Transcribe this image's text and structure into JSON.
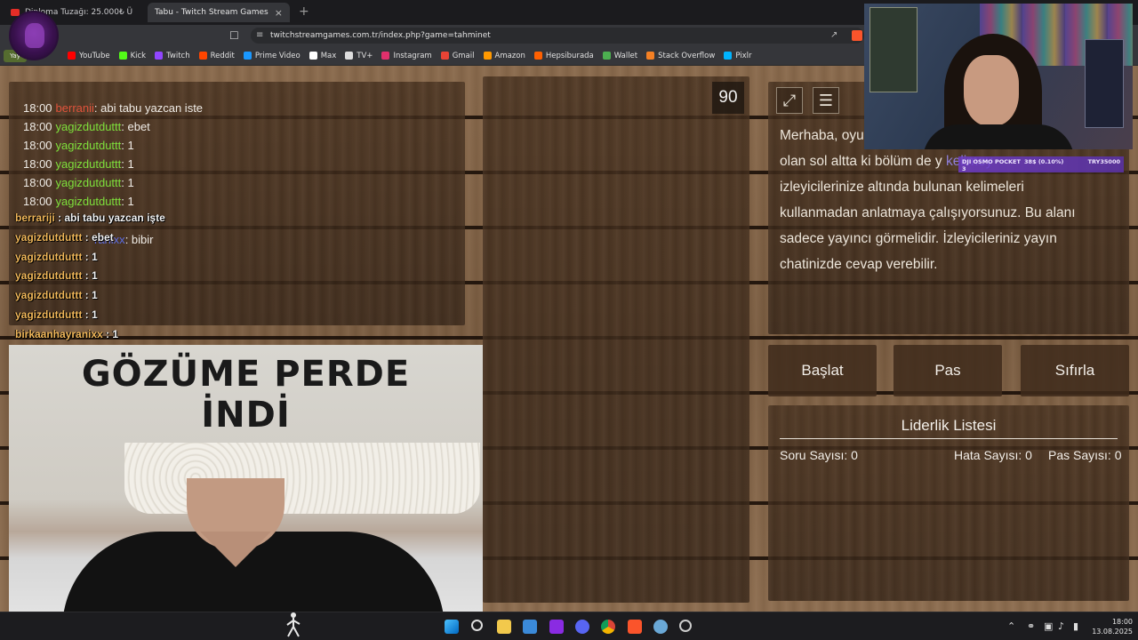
{
  "browser": {
    "tabs": [
      {
        "title": "Diploma Tuzağı: 25.000₺ Ü",
        "close": ""
      },
      {
        "title": "Tabu - Twitch Stream Games",
        "close": "×"
      }
    ],
    "new_tab": "+",
    "url": "twitchstreamgames.com.tr/index.php?game=tahminet",
    "badge": "Yay",
    "bookmarks": [
      {
        "label": "YouTube",
        "color": "#ff0000"
      },
      {
        "label": "Kick",
        "color": "#53fc18"
      },
      {
        "label": "Twitch",
        "color": "#9146ff"
      },
      {
        "label": "Reddit",
        "color": "#ff4500"
      },
      {
        "label": "Prime Video",
        "color": "#1a98ff"
      },
      {
        "label": "Max",
        "color": "#ffffff"
      },
      {
        "label": "TV+",
        "color": "#dddddd"
      },
      {
        "label": "Instagram",
        "color": "#e1306c"
      },
      {
        "label": "Gmail",
        "color": "#ea4335"
      },
      {
        "label": "Amazon",
        "color": "#ff9900"
      },
      {
        "label": "Hepsiburada",
        "color": "#ff6000"
      },
      {
        "label": "Wallet",
        "color": "#4caf50"
      },
      {
        "label": "Stack Overflow",
        "color": "#f48024"
      },
      {
        "label": "Pixlr",
        "color": "#00b4ff"
      }
    ]
  },
  "chat": {
    "lines": [
      {
        "time": "18:00",
        "user": "berranii",
        "user_color": "#e0533b",
        "msg": ": abi tabu yazcan iste"
      },
      {
        "time": "18:00",
        "user": "yagizdutduttt",
        "user_color": "#7ee03b",
        "msg": ": ebet"
      },
      {
        "time": "18:00",
        "user": "yagizdutduttt",
        "user_color": "#7ee03b",
        "msg": ": 1"
      },
      {
        "time": "18:00",
        "user": "yagizdutduttt",
        "user_color": "#7ee03b",
        "msg": ": 1"
      },
      {
        "time": "18:00",
        "user": "yagizdutduttt",
        "user_color": "#7ee03b",
        "msg": ": 1"
      },
      {
        "time": "18:00",
        "user": "yagizdutduttt",
        "user_color": "#7ee03b",
        "msg": ": 1"
      }
    ],
    "ghost_line": {
      "user_tail": "ranixx",
      "msg": ": bibir"
    },
    "overlay": [
      {
        "user": "berrariji",
        "msg": " : abi tabu yazcan işte"
      },
      {
        "user": "yagizdutduttt",
        "msg": " : ebet"
      },
      {
        "user": "yagizdutduttt",
        "msg": " : 1"
      },
      {
        "user": "yagizdutduttt",
        "msg": " : 1"
      },
      {
        "user": "yagizdutduttt",
        "msg": " : 1"
      },
      {
        "user": "yagizdutduttt",
        "msg": " : 1"
      },
      {
        "user": "birkaanhayranixx",
        "msg": " : 1"
      }
    ]
  },
  "meme": {
    "line1": "GÖZÜME PERDE",
    "line2": "İNDİ"
  },
  "timer": "90",
  "info": {
    "text": "Merhaba, oyu... olan sol altta ki bölüm de y... kelimey... izleyicilerinize altında bulunan kelimeleri kullanmadan anlatmaya çalışıyorsunuz. Bu alanı sadece yayıncı görmelidir. İzleyicileriniz yayın chatinizde cevap verebilir.",
    "line1": "Merhaba, oyu",
    "line2": "olan sol altta ki bölüm de y",
    "line2b": "kelimey",
    "line3": "izleyicilerinize altında bulunan kelimeleri",
    "line4": "kullanmadan anlatmaya çalışıyorsunuz. Bu alanı",
    "line5": "sadece yayıncı görmelidir. İzleyicileriniz yayın",
    "line6": "chatinizde cevap verebilir."
  },
  "controls": {
    "start": "Başlat",
    "pass": "Pas",
    "reset": "Sıfırla"
  },
  "leaderboard": {
    "title": "Liderlik Listesi",
    "questions_label": "Soru Sayısı:",
    "questions": "0",
    "errors_label": "Hata Sayısı:",
    "errors": "0",
    "passes_label": "Pas Sayısı:",
    "passes": "0"
  },
  "webcam_overlay": {
    "device": "DJI OSMO POCKET 3",
    "stat": "38$ (0.10%)",
    "price": "TRY35000"
  },
  "taskbar": {
    "time": "18:00",
    "date": "13.08.2025"
  }
}
